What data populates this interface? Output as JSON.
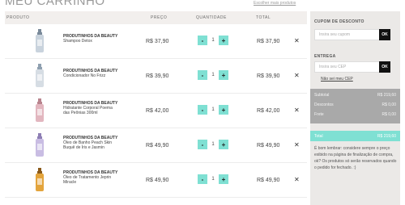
{
  "page": {
    "title": "MEU CARRINHO",
    "continue_link": "Escolher mais produtos"
  },
  "cart": {
    "headers": {
      "product": "PRODUTO",
      "price": "PREÇO",
      "quantity": "QUANTIDADE",
      "total": "TOTAL"
    },
    "items": [
      {
        "brand": "PRODUTINHOS DA BEAUTY",
        "name": "Shampoo Detox",
        "name2": "",
        "price": "R$ 37,90",
        "qty": "1",
        "total": "R$ 37,90",
        "bottle_color": "#c9d3dd",
        "cap_color": "#7a8a9a"
      },
      {
        "brand": "PRODUTINHOS DA BEAUTY",
        "name": "Condicionador No Frizz",
        "name2": "",
        "price": "R$ 39,90",
        "qty": "1",
        "total": "R$ 39,90",
        "bottle_color": "#d6dde4",
        "cap_color": "#8fa0b0"
      },
      {
        "brand": "PRODUTINHOS DA BEAUTY",
        "name": "Hidratante Corporal Poema",
        "name2": "das Peônias 300ml",
        "price": "R$ 42,00",
        "qty": "1",
        "total": "R$ 42,00",
        "bottle_color": "#e2b6bf",
        "cap_color": "#b9848e"
      },
      {
        "brand": "PRODUTINHOS DA BEAUTY",
        "name": "Óleo de Banho Peach Skin",
        "name2": "Buquê de Íris e Jasmin",
        "price": "R$ 49,90",
        "qty": "1",
        "total": "R$ 49,90",
        "bottle_color": "#c9bde3",
        "cap_color": "#8e7fb5"
      },
      {
        "brand": "PRODUTINHOS DA BEAUTY",
        "name": "Óleo de Tratamento Jeprin",
        "name2": "Miracle",
        "price": "R$ 49,90",
        "qty": "1",
        "total": "R$ 49,90",
        "bottle_color": "#e3a43c",
        "cap_color": "#8a5a1a"
      }
    ],
    "minus_label": "-",
    "plus_label": "+",
    "remove_label": "✕"
  },
  "sidebar": {
    "coupon_label": "CUPOM DE DESCONTO",
    "coupon_placeholder": "Insira seu cupom",
    "ok_label": "OK",
    "delivery_label": "ENTREGA",
    "cep_placeholder": "Insira seu CEP",
    "cep_link": "Não sei meu CEP",
    "summary": {
      "subtotal_label": "Subtotal",
      "subtotal_value": "R$ 219,60",
      "discount_label": "Descontos",
      "discount_value": "R$ 0,00",
      "shipping_label": "Frete",
      "shipping_value": "R$ 0,00"
    },
    "total_label": "Total",
    "total_value": "R$ 219,60",
    "note": "É bom lembrar: considere sempre o preço exibido na página de finalização de compra, ok? Os produtos só serão reservados quando o pedido for fechado. :)"
  },
  "colors": {
    "accent": "#7fe0d3",
    "summary_bg": "#a9a9a9",
    "sidebar_bg": "#ebe9e7",
    "header_bg": "#f2efed"
  }
}
